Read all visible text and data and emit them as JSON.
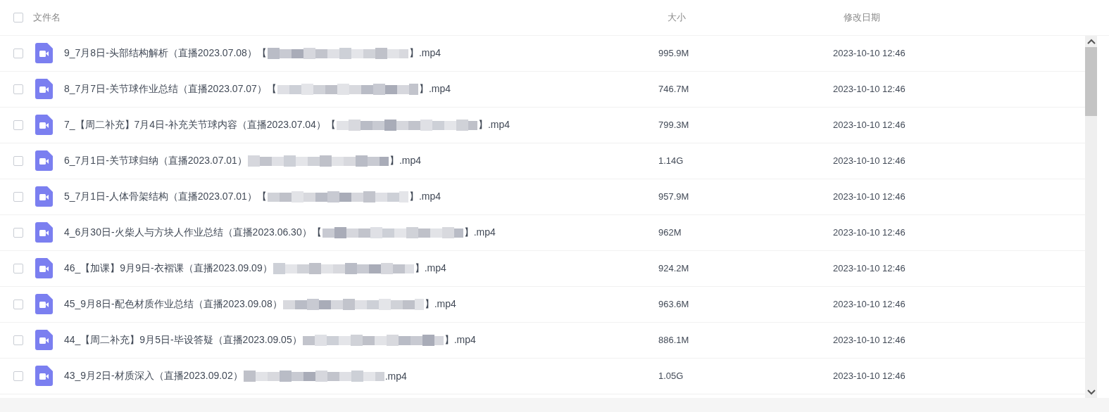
{
  "header": {
    "checked": false,
    "columns": [
      "文件名",
      "大小",
      "修改日期"
    ]
  },
  "rows": [
    {
      "checked": false,
      "name": "9_7月8日-头部结构解析（直播2023.07.08）【",
      "extension": "】.mp4",
      "size": "995.9M",
      "modified": "2023-10-10 12:46"
    },
    {
      "checked": false,
      "name": "8_7月7日-关节球作业总结（直播2023.07.07）【",
      "extension": "】.mp4",
      "size": "746.7M",
      "modified": "2023-10-10 12:46"
    },
    {
      "checked": false,
      "name": "7_【周二补充】7月4日-补充关节球内容（直播2023.07.04）【",
      "extension": "】.mp4",
      "size": "799.3M",
      "modified": "2023-10-10 12:46"
    },
    {
      "checked": false,
      "name": "6_7月1日-关节球归纳（直播2023.07.01）",
      "extension": "】.mp4",
      "size": "1.14G",
      "modified": "2023-10-10 12:46"
    },
    {
      "checked": false,
      "name": "5_7月1日-人体骨架结构（直播2023.07.01）【",
      "extension": "】.mp4",
      "size": "957.9M",
      "modified": "2023-10-10 12:46"
    },
    {
      "checked": false,
      "name": "4_6月30日-火柴人与方块人作业总结（直播2023.06.30）【",
      "extension": "】.mp4",
      "size": "962M",
      "modified": "2023-10-10 12:46"
    },
    {
      "checked": false,
      "name": "46_【加课】9月9日-衣褶课（直播2023.09.09）",
      "extension": "】.mp4",
      "size": "924.2M",
      "modified": "2023-10-10 12:46"
    },
    {
      "checked": false,
      "name": "45_9月8日-配色材质作业总结（直播2023.09.08）",
      "extension": "】.mp4",
      "size": "963.6M",
      "modified": "2023-10-10 12:46"
    },
    {
      "checked": false,
      "name": "44_【周二补充】9月5日-毕设答疑（直播2023.09.05）",
      "extension": "】.mp4",
      "size": "886.1M",
      "modified": "2023-10-10 12:46"
    },
    {
      "checked": false,
      "name": "43_9月2日-材质深入（直播2023.09.02）",
      "extension": ".mp4",
      "size": "1.05G",
      "modified": "2023-10-10 12:46"
    }
  ]
}
